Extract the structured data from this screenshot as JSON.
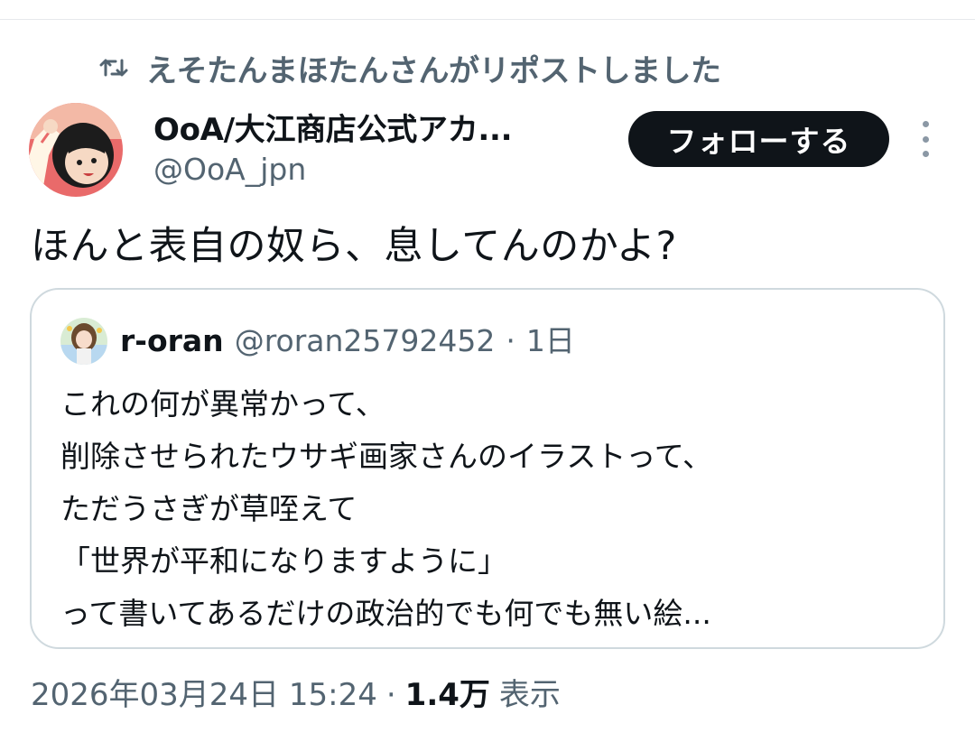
{
  "repost": {
    "icon": "repost-icon",
    "text": "えそたんまほたんさんがリポストしました"
  },
  "author": {
    "name": "OoA/大江商店公式アカ...",
    "handle": "@OoA_jpn",
    "avatar": "avatar-anime-girl"
  },
  "actions": {
    "follow_label": "フォローする",
    "more_icon": "more-vertical-icon"
  },
  "tweet": {
    "text": "ほんと表自の奴ら、息してんのかよ?"
  },
  "quote": {
    "name": "r-oran",
    "handle": "@roran25792452",
    "separator": "·",
    "time": "1日",
    "lines": [
      "これの何が異常かって、",
      "削除させられたウサギ画家さんのイラストって、",
      "ただうさぎが草咥えて",
      "「世界が平和になりますように」",
      "って書いてあるだけの政治的でも何でも無い絵..."
    ]
  },
  "meta": {
    "datetime": "2026年03月24日 15:24",
    "separator": "·",
    "views_count": "1.4万",
    "views_label": "表示"
  },
  "colors": {
    "text_primary": "#0f1419",
    "text_secondary": "#536471",
    "border": "#cfd9de",
    "button_bg": "#0f1419"
  }
}
